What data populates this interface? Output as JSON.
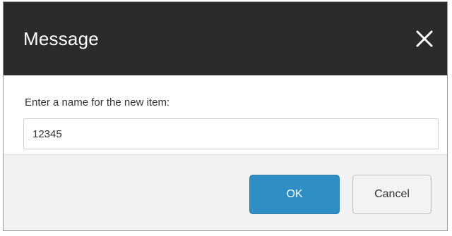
{
  "dialog": {
    "title": "Message",
    "close_icon": "close-icon",
    "prompt": "Enter a name for the new item:",
    "input_value": "12345",
    "ok_label": "OK",
    "cancel_label": "Cancel"
  },
  "colors": {
    "titlebar": "#2b2b2b",
    "ok_button": "#2f8fc4",
    "footer": "#f2f2f2"
  }
}
